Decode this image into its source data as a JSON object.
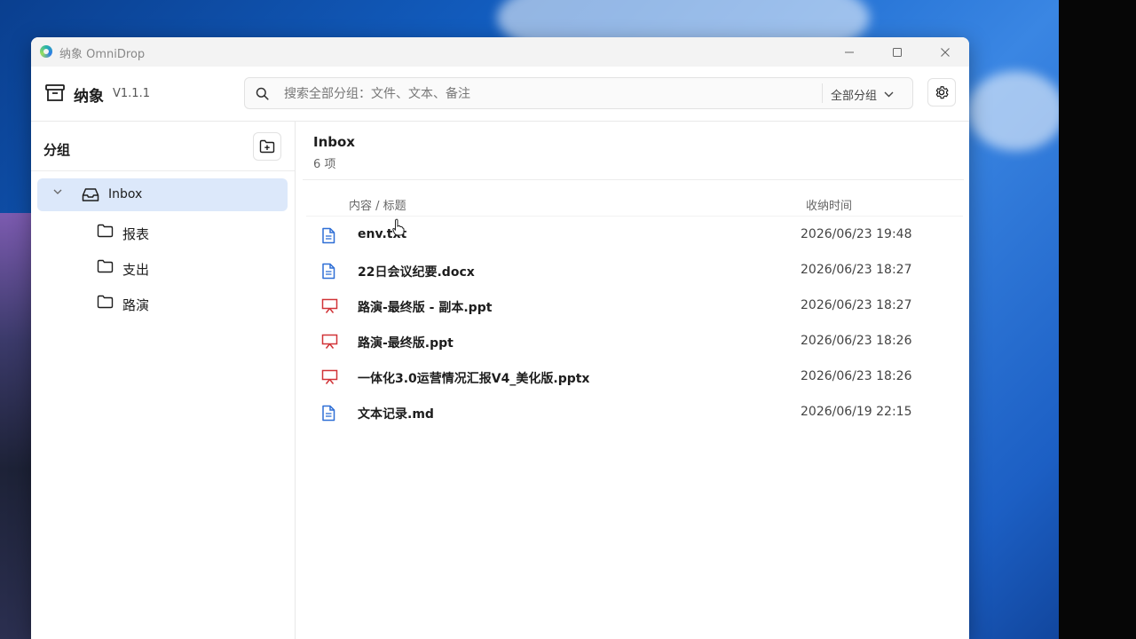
{
  "window": {
    "title": "纳象 OmniDrop"
  },
  "header": {
    "brand_name": "纳象",
    "version": "V1.1.1",
    "search_placeholder": "搜索全部分组：文件、文本、备注",
    "scope_label": "全部分组"
  },
  "sidebar": {
    "title": "分组",
    "groups": [
      {
        "label": "Inbox",
        "expanded": true,
        "selected": true,
        "children": [
          {
            "label": "报表"
          },
          {
            "label": "支出"
          },
          {
            "label": "路演"
          }
        ]
      }
    ]
  },
  "main": {
    "title": "Inbox",
    "count": "6 项",
    "columns": {
      "content": "内容 / 标题",
      "time": "收纳时间"
    },
    "items": [
      {
        "name": "env.txt",
        "time": "2026/06/23 19:48",
        "icon": "document-icon"
      },
      {
        "name": "22日会议纪要.docx",
        "time": "2026/06/23 18:27",
        "icon": "document-icon"
      },
      {
        "name": "路演-最终版 - 副本.ppt",
        "time": "2026/06/23 18:27",
        "icon": "presentation-icon"
      },
      {
        "name": "路演-最终版.ppt",
        "time": "2026/06/23 18:26",
        "icon": "presentation-icon"
      },
      {
        "name": "一体化3.0运营情况汇报V4_美化版.pptx",
        "time": "2026/06/23 18:26",
        "icon": "presentation-icon"
      },
      {
        "name": "文本记录.md",
        "time": "2026/06/19 22:15",
        "icon": "document-icon"
      }
    ]
  },
  "colors": {
    "selected_bg": "#dce8fa",
    "doc_icon": "#2f6fd6",
    "ppt_icon": "#d13438"
  }
}
